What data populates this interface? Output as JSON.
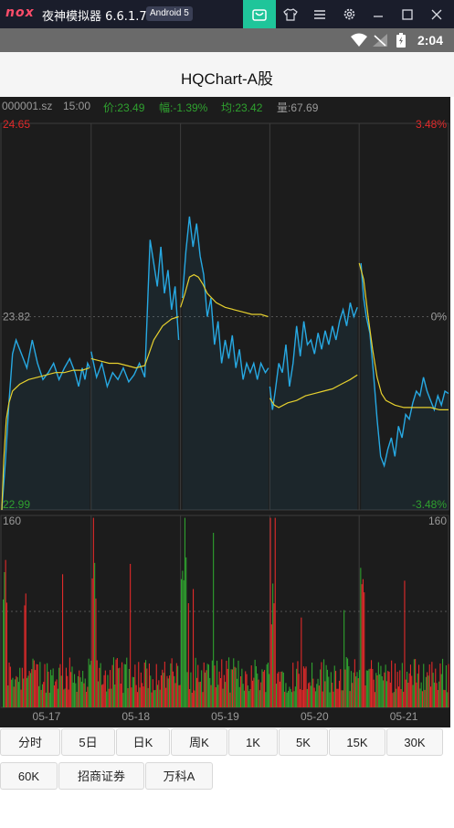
{
  "emulator": {
    "logo": "nox",
    "title": "夜神模拟器 6.6.1.7",
    "android_badge": "Android 5",
    "icons": [
      "store-icon",
      "shirt-icon",
      "menu-icon",
      "gear-icon",
      "minimize-icon",
      "maximize-icon",
      "close-icon"
    ]
  },
  "statusbar": {
    "time": "2:04",
    "icons": [
      "wifi-icon",
      "signal-icon",
      "battery-icon"
    ]
  },
  "app": {
    "title": "HQChart-A股"
  },
  "chart_info": {
    "symbol": "000001.sz",
    "time": "15:00",
    "price": "价:23.49",
    "change": "幅:-1.39%",
    "avg": "均:23.42",
    "volume": "量:67.69"
  },
  "chart_data": {
    "type": "line",
    "x_labels": [
      "05-17",
      "05-18",
      "05-19",
      "05-20",
      "05-21"
    ],
    "y_left_ticks": [
      "24.65",
      "23.82",
      "22.99"
    ],
    "y_right_ticks": [
      "3.48%",
      "0%",
      "-3.48%"
    ],
    "ylim": [
      22.99,
      24.65
    ],
    "volume_axis_left": "160",
    "volume_axis_right": "160",
    "volume_ylim": [
      0,
      160
    ],
    "series": [
      {
        "points": [
          [
            0,
            22.99
          ],
          [
            0.04,
            23.2
          ],
          [
            0.08,
            23.45
          ],
          [
            0.12,
            23.66
          ],
          [
            0.16,
            23.72
          ],
          [
            0.22,
            23.66
          ],
          [
            0.28,
            23.6
          ],
          [
            0.34,
            23.72
          ],
          [
            0.4,
            23.62
          ],
          [
            0.46,
            23.55
          ],
          [
            0.52,
            23.58
          ],
          [
            0.58,
            23.62
          ],
          [
            0.64,
            23.55
          ],
          [
            0.7,
            23.6
          ],
          [
            0.76,
            23.64
          ],
          [
            0.82,
            23.58
          ],
          [
            0.86,
            23.52
          ],
          [
            0.9,
            23.6
          ],
          [
            0.93,
            23.55
          ],
          [
            0.96,
            23.62
          ],
          [
            0.985,
            23.6
          ],
          [
            1.0,
            23.67
          ],
          [
            1.06,
            23.56
          ],
          [
            1.12,
            23.62
          ],
          [
            1.18,
            23.52
          ],
          [
            1.24,
            23.58
          ],
          [
            1.3,
            23.55
          ],
          [
            1.36,
            23.6
          ],
          [
            1.42,
            23.54
          ],
          [
            1.48,
            23.57
          ],
          [
            1.54,
            23.62
          ],
          [
            1.6,
            23.56
          ],
          [
            1.66,
            24.15
          ],
          [
            1.7,
            24.05
          ],
          [
            1.74,
            23.95
          ],
          [
            1.78,
            24.12
          ],
          [
            1.82,
            23.92
          ],
          [
            1.86,
            24.02
          ],
          [
            1.9,
            23.85
          ],
          [
            1.94,
            23.95
          ],
          [
            1.98,
            23.72
          ],
          [
            2.02,
            23.9
          ],
          [
            2.06,
            24.1
          ],
          [
            2.1,
            24.25
          ],
          [
            2.14,
            24.12
          ],
          [
            2.18,
            24.22
          ],
          [
            2.22,
            24.08
          ],
          [
            2.26,
            24.0
          ],
          [
            2.3,
            23.82
          ],
          [
            2.34,
            23.9
          ],
          [
            2.38,
            23.7
          ],
          [
            2.42,
            23.8
          ],
          [
            2.46,
            23.62
          ],
          [
            2.5,
            23.72
          ],
          [
            2.54,
            23.64
          ],
          [
            2.58,
            23.74
          ],
          [
            2.62,
            23.6
          ],
          [
            2.66,
            23.68
          ],
          [
            2.7,
            23.55
          ],
          [
            2.74,
            23.62
          ],
          [
            2.78,
            23.58
          ],
          [
            2.82,
            23.62
          ],
          [
            2.86,
            23.55
          ],
          [
            2.9,
            23.62
          ],
          [
            2.95,
            23.58
          ],
          [
            2.985,
            23.6
          ],
          [
            3.0,
            23.52
          ],
          [
            3.03,
            23.42
          ],
          [
            3.06,
            23.5
          ],
          [
            3.1,
            23.62
          ],
          [
            3.14,
            23.58
          ],
          [
            3.18,
            23.7
          ],
          [
            3.22,
            23.52
          ],
          [
            3.26,
            23.62
          ],
          [
            3.3,
            23.78
          ],
          [
            3.34,
            23.65
          ],
          [
            3.38,
            23.8
          ],
          [
            3.42,
            23.7
          ],
          [
            3.46,
            23.72
          ],
          [
            3.5,
            23.66
          ],
          [
            3.54,
            23.75
          ],
          [
            3.58,
            23.68
          ],
          [
            3.62,
            23.76
          ],
          [
            3.66,
            23.7
          ],
          [
            3.7,
            23.78
          ],
          [
            3.74,
            23.72
          ],
          [
            3.78,
            23.8
          ],
          [
            3.82,
            23.85
          ],
          [
            3.86,
            23.78
          ],
          [
            3.9,
            23.88
          ],
          [
            3.94,
            23.82
          ],
          [
            3.98,
            23.86
          ],
          [
            4.02,
            24.05
          ],
          [
            4.05,
            23.9
          ],
          [
            4.08,
            23.82
          ],
          [
            4.12,
            23.75
          ],
          [
            4.16,
            23.58
          ],
          [
            4.2,
            23.38
          ],
          [
            4.24,
            23.22
          ],
          [
            4.28,
            23.18
          ],
          [
            4.32,
            23.25
          ],
          [
            4.36,
            23.3
          ],
          [
            4.4,
            23.22
          ],
          [
            4.44,
            23.35
          ],
          [
            4.48,
            23.3
          ],
          [
            4.52,
            23.4
          ],
          [
            4.56,
            23.38
          ],
          [
            4.6,
            23.45
          ],
          [
            4.64,
            23.5
          ],
          [
            4.68,
            23.48
          ],
          [
            4.72,
            23.56
          ],
          [
            4.76,
            23.5
          ],
          [
            4.8,
            23.46
          ],
          [
            4.84,
            23.42
          ],
          [
            4.88,
            23.48
          ],
          [
            4.92,
            23.44
          ],
          [
            4.96,
            23.5
          ],
          [
            5.0,
            23.49
          ]
        ]
      },
      {
        "points": [
          [
            0,
            22.99
          ],
          [
            0.02,
            23.2
          ],
          [
            0.05,
            23.38
          ],
          [
            0.08,
            23.45
          ],
          [
            0.12,
            23.5
          ],
          [
            0.2,
            23.53
          ],
          [
            0.3,
            23.55
          ],
          [
            0.4,
            23.56
          ],
          [
            0.5,
            23.57
          ],
          [
            0.6,
            23.58
          ],
          [
            0.7,
            23.58
          ],
          [
            0.8,
            23.59
          ],
          [
            0.9,
            23.59
          ],
          [
            0.98,
            23.6
          ],
          [
            1.0,
            23.64
          ],
          [
            1.1,
            23.63
          ],
          [
            1.2,
            23.62
          ],
          [
            1.3,
            23.62
          ],
          [
            1.4,
            23.61
          ],
          [
            1.5,
            23.6
          ],
          [
            1.6,
            23.61
          ],
          [
            1.7,
            23.72
          ],
          [
            1.8,
            23.78
          ],
          [
            1.9,
            23.81
          ],
          [
            1.98,
            23.82
          ],
          [
            2.0,
            23.86
          ],
          [
            2.05,
            23.92
          ],
          [
            2.1,
            23.99
          ],
          [
            2.15,
            24.0
          ],
          [
            2.2,
            23.99
          ],
          [
            2.25,
            23.96
          ],
          [
            2.3,
            23.92
          ],
          [
            2.4,
            23.88
          ],
          [
            2.5,
            23.86
          ],
          [
            2.6,
            23.85
          ],
          [
            2.7,
            23.84
          ],
          [
            2.8,
            23.83
          ],
          [
            2.9,
            23.83
          ],
          [
            2.98,
            23.82
          ],
          [
            3.0,
            23.47
          ],
          [
            3.05,
            23.44
          ],
          [
            3.1,
            23.43
          ],
          [
            3.2,
            23.45
          ],
          [
            3.3,
            23.46
          ],
          [
            3.4,
            23.48
          ],
          [
            3.5,
            23.49
          ],
          [
            3.6,
            23.5
          ],
          [
            3.7,
            23.51
          ],
          [
            3.8,
            23.53
          ],
          [
            3.9,
            23.55
          ],
          [
            3.98,
            23.57
          ],
          [
            4.0,
            24.05
          ],
          [
            4.05,
            23.98
          ],
          [
            4.1,
            23.82
          ],
          [
            4.15,
            23.68
          ],
          [
            4.2,
            23.56
          ],
          [
            4.25,
            23.49
          ],
          [
            4.3,
            23.46
          ],
          [
            4.4,
            23.44
          ],
          [
            4.5,
            23.43
          ],
          [
            4.6,
            23.43
          ],
          [
            4.7,
            23.43
          ],
          [
            4.8,
            23.43
          ],
          [
            4.9,
            23.42
          ],
          [
            5.0,
            23.42
          ]
        ]
      }
    ]
  },
  "colors": {
    "bg": "#1c1c1c",
    "price_line": "#27a9e3",
    "avg_line": "#e6d02e",
    "up": "#e12a2a",
    "down": "#2fa12f",
    "grid": "#3c3c3c",
    "axis_text": "#9a9a9a"
  },
  "buttons": [
    "分时",
    "5日",
    "日K",
    "周K",
    "1K",
    "5K",
    "15K",
    "30K",
    "60K",
    "招商证券",
    "万科A"
  ]
}
